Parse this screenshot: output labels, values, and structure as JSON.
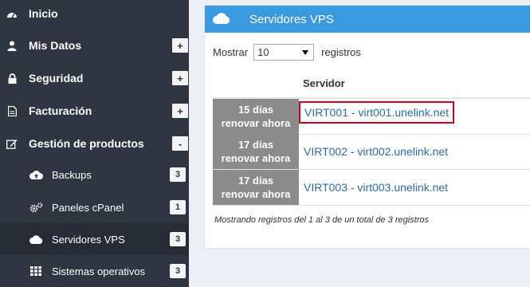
{
  "sidebar": {
    "items": [
      {
        "label": "Inicio",
        "icon": "dashboard-icon"
      },
      {
        "label": "Mis Datos",
        "icon": "user-icon",
        "toggle": "+"
      },
      {
        "label": "Seguridad",
        "icon": "lock-icon",
        "toggle": "+"
      },
      {
        "label": "Facturación",
        "icon": "file-icon",
        "toggle": "+"
      },
      {
        "label": "Gestión de productos",
        "icon": "edit-icon",
        "toggle": "-"
      }
    ],
    "subitems": [
      {
        "label": "Backups",
        "icon": "cloud-upload-icon",
        "count": "3"
      },
      {
        "label": "Paneles cPanel",
        "icon": "gears-icon",
        "count": "1"
      },
      {
        "label": "Servidores VPS",
        "icon": "cloud-icon",
        "count": "3",
        "active": true
      },
      {
        "label": "Sistemas operativos",
        "icon": "grid-icon",
        "count": "3"
      }
    ]
  },
  "panel": {
    "title": "Servidores VPS",
    "icon": "cloud-icon",
    "header_color": "#3a9ae0",
    "length": {
      "prefix": "Mostrar",
      "value": "10",
      "suffix": "registros"
    },
    "column_header": "Servidor",
    "rows": [
      {
        "badge_line1": "15 días",
        "badge_line2": "renovar ahora",
        "server": "VIRT001 - virt001.unelink.net",
        "highlighted": true
      },
      {
        "badge_line1": "17 días",
        "badge_line2": "renovar ahora",
        "server": "VIRT002 - virt002.unelink.net"
      },
      {
        "badge_line1": "17 días",
        "badge_line2": "renovar ahora",
        "server": "VIRT003 - virt003.unelink.net"
      }
    ],
    "info": "Mostrando registros del 1 al 3 de un total de 3 registros"
  },
  "colors": {
    "sidebar_bg": "#2f3541",
    "badge_bg": "#8b8b8b",
    "link": "#2f6aa6",
    "highlight": "#d0021b"
  }
}
